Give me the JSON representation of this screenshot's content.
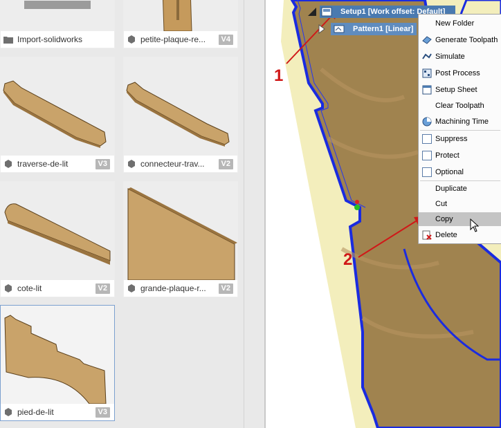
{
  "library": {
    "cards": [
      {
        "name": "Import-solidworks",
        "version": "",
        "type": "folder"
      },
      {
        "name": "petite-plaque-re...",
        "version": "V4",
        "type": "part"
      },
      {
        "name": "traverse-de-lit",
        "version": "V3",
        "type": "part"
      },
      {
        "name": "connecteur-trav...",
        "version": "V2",
        "type": "part"
      },
      {
        "name": "cote-lit",
        "version": "V2",
        "type": "part"
      },
      {
        "name": "grande-plaque-r...",
        "version": "V2",
        "type": "part"
      },
      {
        "name": "pied-de-lit",
        "version": "V3",
        "type": "part"
      }
    ]
  },
  "browser": {
    "setup_label": "Setup1 [Work offset: Default]",
    "pattern_label": "Pattern1 [Linear]"
  },
  "context_menu": {
    "items": [
      {
        "label": "New Folder",
        "icon": "none"
      },
      {
        "label": "Generate Toolpath",
        "icon": "generate-toolpath-icon"
      },
      {
        "label": "Simulate",
        "icon": "simulate-icon"
      },
      {
        "label": "Post Process",
        "icon": "post-process-icon"
      },
      {
        "label": "Setup Sheet",
        "icon": "setup-sheet-icon"
      },
      {
        "label": "Clear Toolpath",
        "icon": "none"
      },
      {
        "label": "Machining Time",
        "icon": "machining-time-icon"
      },
      {
        "label": "Suppress",
        "icon": "checkbox-icon"
      },
      {
        "label": "Protect",
        "icon": "checkbox-icon"
      },
      {
        "label": "Optional",
        "icon": "checkbox-icon"
      },
      {
        "label": "Duplicate",
        "icon": "none"
      },
      {
        "label": "Cut",
        "icon": "none"
      },
      {
        "label": "Copy",
        "icon": "none"
      },
      {
        "label": "Delete",
        "icon": "delete-icon"
      }
    ],
    "highlighted": "Copy"
  },
  "annotations": {
    "step1": "1",
    "step2": "2"
  },
  "colors": {
    "annotation": "#d01818",
    "wood": "#c9a36a",
    "toolpath": "#1a2be0",
    "stock": "#f3eebc",
    "selection_blue": "#4a7ab0"
  }
}
